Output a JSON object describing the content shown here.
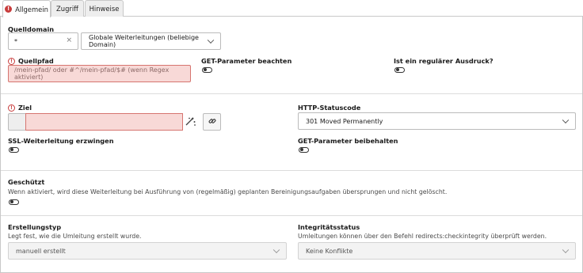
{
  "tabs": [
    {
      "label": "Allgemein",
      "active": true,
      "has_error": true,
      "error_glyph": "!"
    },
    {
      "label": "Zugriff",
      "active": false
    },
    {
      "label": "Hinweise",
      "active": false
    }
  ],
  "quelldomain": {
    "label": "Quelldomain",
    "value": "*",
    "clear_icon": "close-icon",
    "select_value": "Globale Weiterleitungen (beliebige Domain)"
  },
  "quellpfad": {
    "label": "Quellpfad",
    "placeholder": "/mein-pfad/ oder #^/mein-pfad/$# (wenn Regex aktiviert)",
    "warn_glyph": "!"
  },
  "get_parameter_beachten": {
    "label": "GET-Parameter beachten",
    "checked": false
  },
  "regex": {
    "label": "Ist ein regulärer Ausdruck?",
    "checked": false
  },
  "ziel": {
    "label": "Ziel",
    "value": "",
    "warn_glyph": "!",
    "wizard_icon": "wizard-icon",
    "link_icon": "link-icon"
  },
  "http_statuscode": {
    "label": "HTTP-Statuscode",
    "value": "301 Moved Permanently"
  },
  "ssl": {
    "label": "SSL-Weiterleitung erzwingen",
    "checked": false
  },
  "get_parameter_beibehalten": {
    "label": "GET-Parameter beibehalten",
    "checked": false
  },
  "geschuetzt": {
    "label": "Geschützt",
    "description": "Wenn aktiviert, wird diese Weiterleitung bei Ausführung von (regelmäßig) geplanten Bereinigungsaufgaben übersprungen und nicht gelöscht.",
    "checked": false
  },
  "erstellungstyp": {
    "label": "Erstellungstyp",
    "description": "Legt fest, wie die Umleitung erstellt wurde.",
    "value": "manuell erstellt"
  },
  "integritaetsstatus": {
    "label": "Integritätsstatus",
    "description": "Umleitungen können über den Befehl redirects:checkintegrity überprüft werden.",
    "value": "Keine Konflikte"
  },
  "colors": {
    "error_red": "#c83c3c",
    "error_bg": "#f8d9d7",
    "border": "#bbbbbb"
  }
}
